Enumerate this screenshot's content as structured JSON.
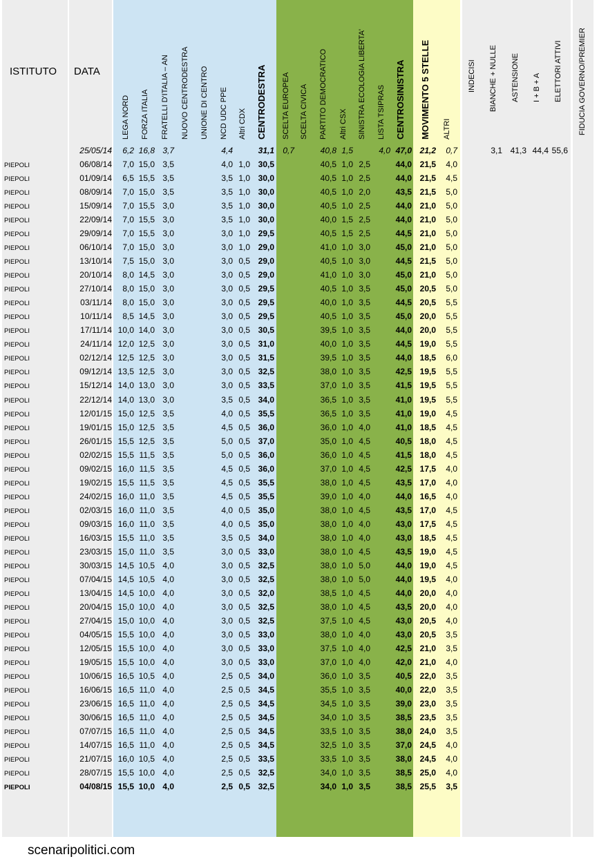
{
  "columns": {
    "istituto": "ISTITUTO",
    "data": "DATA",
    "lega_nord": "LEGA NORD",
    "forza_italia": "FORZA ITALIA",
    "fratelli_italia": "FRATELLI D'ITALIA – AN",
    "nuovo_centrodestra": "NUOVO  CENTRODESTRA",
    "unione_centro": "UNIONE DI CENTRO",
    "ncd_udc_ppe": "NCD UDC PPE",
    "altri_cdx": "Altri CDX",
    "centrodestra": "CENTRODESTRA",
    "scelta_europea": "SCELTA EUROPEA",
    "scelta_civica": "SCELTA CIVICA",
    "partito_democratico": "PARTITO DEMOCRATICO",
    "altri_csx": "Altri CSX",
    "sel": "SINISTRA ECOLOGIA LIBERTA'",
    "lista_tsipras": "LISTA TSIPRAS",
    "centrosinistra": "CENTROSINISTRA",
    "m5s": "MOVIMENTO 5 STELLE",
    "altri": "ALTRI",
    "indecisi": "INDECISI",
    "bianche_nulle": "BIANCHE + NULLE",
    "astensione": "ASTENSIONE",
    "ibna": "I + B + A",
    "elettori_attivi": "ELETTORI ATTIVI",
    "fiducia": "FIDUCIA GOVERNO/PREMIER"
  },
  "colors": {
    "grey_band": "#ededed",
    "blue_band": "#cde4f3",
    "green_band": "#89b24a",
    "yellow_band": "#fdfcc6"
  },
  "election_row": {
    "date": "25/05/14",
    "lega_nord": "6,2",
    "forza_italia": "16,8",
    "fratelli_italia": "3,7",
    "ncd_udc_ppe": "4,4",
    "centrodestra": "31,1",
    "scelta_europea": "0,7",
    "partito_democratico": "40,8",
    "altri_csx": "1,5",
    "lista_tsipras": "4,0",
    "centrosinistra": "47,0",
    "m5s": "21,2",
    "altri": "0,7",
    "bianche_nulle": "3,1",
    "astensione": "41,3",
    "ibna": "44,4",
    "elettori_attivi": "55,6"
  },
  "rows": [
    [
      "PIEPOLI",
      "06/08/14",
      "7,0",
      "15,0",
      "3,5",
      "4,0",
      "1,0",
      "30,5",
      "40,5",
      "1,0",
      "2,5",
      "44,0",
      "21,5",
      "4,0"
    ],
    [
      "PIEPOLI",
      "01/09/14",
      "6,5",
      "15,5",
      "3,5",
      "3,5",
      "1,0",
      "30,0",
      "40,5",
      "1,0",
      "2,5",
      "44,0",
      "21,5",
      "4,5"
    ],
    [
      "PIEPOLI",
      "08/09/14",
      "7,0",
      "15,0",
      "3,5",
      "3,5",
      "1,0",
      "30,0",
      "40,5",
      "1,0",
      "2,0",
      "43,5",
      "21,5",
      "5,0"
    ],
    [
      "PIEPOLI",
      "15/09/14",
      "7,0",
      "15,5",
      "3,0",
      "3,5",
      "1,0",
      "30,0",
      "40,5",
      "1,0",
      "2,5",
      "44,0",
      "21,0",
      "5,0"
    ],
    [
      "PIEPOLI",
      "22/09/14",
      "7,0",
      "15,5",
      "3,0",
      "3,5",
      "1,0",
      "30,0",
      "40,0",
      "1,5",
      "2,5",
      "44,0",
      "21,0",
      "5,0"
    ],
    [
      "PIEPOLI",
      "29/09/14",
      "7,0",
      "15,5",
      "3,0",
      "3,0",
      "1,0",
      "29,5",
      "40,5",
      "1,5",
      "2,5",
      "44,5",
      "21,0",
      "5,0"
    ],
    [
      "PIEPOLI",
      "06/10/14",
      "7,0",
      "15,0",
      "3,0",
      "3,0",
      "1,0",
      "29,0",
      "41,0",
      "1,0",
      "3,0",
      "45,0",
      "21,0",
      "5,0"
    ],
    [
      "PIEPOLI",
      "13/10/14",
      "7,5",
      "15,0",
      "3,0",
      "3,0",
      "0,5",
      "29,0",
      "40,5",
      "1,0",
      "3,0",
      "44,5",
      "21,5",
      "5,0"
    ],
    [
      "PIEPOLI",
      "20/10/14",
      "8,0",
      "14,5",
      "3,0",
      "3,0",
      "0,5",
      "29,0",
      "41,0",
      "1,0",
      "3,0",
      "45,0",
      "21,0",
      "5,0"
    ],
    [
      "PIEPOLI",
      "27/10/14",
      "8,0",
      "15,0",
      "3,0",
      "3,0",
      "0,5",
      "29,5",
      "40,5",
      "1,0",
      "3,5",
      "45,0",
      "20,5",
      "5,0"
    ],
    [
      "PIEPOLI",
      "03/11/14",
      "8,0",
      "15,0",
      "3,0",
      "3,0",
      "0,5",
      "29,5",
      "40,0",
      "1,0",
      "3,5",
      "44,5",
      "20,5",
      "5,5"
    ],
    [
      "PIEPOLI",
      "10/11/14",
      "8,5",
      "14,5",
      "3,0",
      "3,0",
      "0,5",
      "29,5",
      "40,5",
      "1,0",
      "3,5",
      "45,0",
      "20,0",
      "5,5"
    ],
    [
      "PIEPOLI",
      "17/11/14",
      "10,0",
      "14,0",
      "3,0",
      "3,0",
      "0,5",
      "30,5",
      "39,5",
      "1,0",
      "3,5",
      "44,0",
      "20,0",
      "5,5"
    ],
    [
      "PIEPOLI",
      "24/11/14",
      "12,0",
      "12,5",
      "3,0",
      "3,0",
      "0,5",
      "31,0",
      "40,0",
      "1,0",
      "3,5",
      "44,5",
      "19,0",
      "5,5"
    ],
    [
      "PIEPOLI",
      "02/12/14",
      "12,5",
      "12,5",
      "3,0",
      "3,0",
      "0,5",
      "31,5",
      "39,5",
      "1,0",
      "3,5",
      "44,0",
      "18,5",
      "6,0"
    ],
    [
      "PIEPOLI",
      "09/12/14",
      "13,5",
      "12,5",
      "3,0",
      "3,0",
      "0,5",
      "32,5",
      "38,0",
      "1,0",
      "3,5",
      "42,5",
      "19,5",
      "5,5"
    ],
    [
      "PIEPOLI",
      "15/12/14",
      "14,0",
      "13,0",
      "3,0",
      "3,0",
      "0,5",
      "33,5",
      "37,0",
      "1,0",
      "3,5",
      "41,5",
      "19,5",
      "5,5"
    ],
    [
      "PIEPOLI",
      "22/12/14",
      "14,0",
      "13,0",
      "3,0",
      "3,5",
      "0,5",
      "34,0",
      "36,5",
      "1,0",
      "3,5",
      "41,0",
      "19,5",
      "5,5"
    ],
    [
      "PIEPOLI",
      "12/01/15",
      "15,0",
      "12,5",
      "3,5",
      "4,0",
      "0,5",
      "35,5",
      "36,5",
      "1,0",
      "3,5",
      "41,0",
      "19,0",
      "4,5"
    ],
    [
      "PIEPOLI",
      "19/01/15",
      "15,0",
      "12,5",
      "3,5",
      "4,5",
      "0,5",
      "36,0",
      "36,0",
      "1,0",
      "4,0",
      "41,0",
      "18,5",
      "4,5"
    ],
    [
      "PIEPOLI",
      "26/01/15",
      "15,5",
      "12,5",
      "3,5",
      "5,0",
      "0,5",
      "37,0",
      "35,0",
      "1,0",
      "4,5",
      "40,5",
      "18,0",
      "4,5"
    ],
    [
      "PIEPOLI",
      "02/02/15",
      "15,5",
      "11,5",
      "3,5",
      "5,0",
      "0,5",
      "36,0",
      "36,0",
      "1,0",
      "4,5",
      "41,5",
      "18,0",
      "4,5"
    ],
    [
      "PIEPOLI",
      "09/02/15",
      "16,0",
      "11,5",
      "3,5",
      "4,5",
      "0,5",
      "36,0",
      "37,0",
      "1,0",
      "4,5",
      "42,5",
      "17,5",
      "4,0"
    ],
    [
      "PIEPOLI",
      "19/02/15",
      "15,5",
      "11,5",
      "3,5",
      "4,5",
      "0,5",
      "35,5",
      "38,0",
      "1,0",
      "4,5",
      "43,5",
      "17,0",
      "4,0"
    ],
    [
      "PIEPOLI",
      "24/02/15",
      "16,0",
      "11,0",
      "3,5",
      "4,5",
      "0,5",
      "35,5",
      "39,0",
      "1,0",
      "4,0",
      "44,0",
      "16,5",
      "4,0"
    ],
    [
      "PIEPOLI",
      "02/03/15",
      "16,0",
      "11,0",
      "3,5",
      "4,0",
      "0,5",
      "35,0",
      "38,0",
      "1,0",
      "4,5",
      "43,5",
      "17,0",
      "4,5"
    ],
    [
      "PIEPOLI",
      "09/03/15",
      "16,0",
      "11,0",
      "3,5",
      "4,0",
      "0,5",
      "35,0",
      "38,0",
      "1,0",
      "4,0",
      "43,0",
      "17,5",
      "4,5"
    ],
    [
      "PIEPOLI",
      "16/03/15",
      "15,5",
      "11,0",
      "3,5",
      "3,5",
      "0,5",
      "34,0",
      "38,0",
      "1,0",
      "4,0",
      "43,0",
      "18,5",
      "4,5"
    ],
    [
      "PIEPOLI",
      "23/03/15",
      "15,0",
      "11,0",
      "3,5",
      "3,0",
      "0,5",
      "33,0",
      "38,0",
      "1,0",
      "4,5",
      "43,5",
      "19,0",
      "4,5"
    ],
    [
      "PIEPOLI",
      "30/03/15",
      "14,5",
      "10,5",
      "4,0",
      "3,0",
      "0,5",
      "32,5",
      "38,0",
      "1,0",
      "5,0",
      "44,0",
      "19,0",
      "4,5"
    ],
    [
      "PIEPOLI",
      "07/04/15",
      "14,5",
      "10,5",
      "4,0",
      "3,0",
      "0,5",
      "32,5",
      "38,0",
      "1,0",
      "5,0",
      "44,0",
      "19,5",
      "4,0"
    ],
    [
      "PIEPOLI",
      "13/04/15",
      "14,5",
      "10,0",
      "4,0",
      "3,0",
      "0,5",
      "32,0",
      "38,5",
      "1,0",
      "4,5",
      "44,0",
      "20,0",
      "4,0"
    ],
    [
      "PIEPOLI",
      "20/04/15",
      "15,0",
      "10,0",
      "4,0",
      "3,0",
      "0,5",
      "32,5",
      "38,0",
      "1,0",
      "4,5",
      "43,5",
      "20,0",
      "4,0"
    ],
    [
      "PIEPOLI",
      "27/04/15",
      "15,0",
      "10,0",
      "4,0",
      "3,0",
      "0,5",
      "32,5",
      "37,5",
      "1,0",
      "4,5",
      "43,0",
      "20,5",
      "4,0"
    ],
    [
      "PIEPOLI",
      "04/05/15",
      "15,5",
      "10,0",
      "4,0",
      "3,0",
      "0,5",
      "33,0",
      "38,0",
      "1,0",
      "4,0",
      "43,0",
      "20,5",
      "3,5"
    ],
    [
      "PIEPOLI",
      "12/05/15",
      "15,5",
      "10,0",
      "4,0",
      "3,0",
      "0,5",
      "33,0",
      "37,5",
      "1,0",
      "4,0",
      "42,5",
      "21,0",
      "3,5"
    ],
    [
      "PIEPOLI",
      "19/05/15",
      "15,5",
      "10,0",
      "4,0",
      "3,0",
      "0,5",
      "33,0",
      "37,0",
      "1,0",
      "4,0",
      "42,0",
      "21,0",
      "4,0"
    ],
    [
      "PIEPOLI",
      "10/06/15",
      "16,5",
      "10,5",
      "4,0",
      "2,5",
      "0,5",
      "34,0",
      "36,0",
      "1,0",
      "3,5",
      "40,5",
      "22,0",
      "3,5"
    ],
    [
      "PIEPOLI",
      "16/06/15",
      "16,5",
      "11,0",
      "4,0",
      "2,5",
      "0,5",
      "34,5",
      "35,5",
      "1,0",
      "3,5",
      "40,0",
      "22,0",
      "3,5"
    ],
    [
      "PIEPOLI",
      "23/06/15",
      "16,5",
      "11,0",
      "4,0",
      "2,5",
      "0,5",
      "34,5",
      "34,5",
      "1,0",
      "3,5",
      "39,0",
      "23,0",
      "3,5"
    ],
    [
      "PIEPOLI",
      "30/06/15",
      "16,5",
      "11,0",
      "4,0",
      "2,5",
      "0,5",
      "34,5",
      "34,0",
      "1,0",
      "3,5",
      "38,5",
      "23,5",
      "3,5"
    ],
    [
      "PIEPOLI",
      "07/07/15",
      "16,5",
      "11,0",
      "4,0",
      "2,5",
      "0,5",
      "34,5",
      "33,5",
      "1,0",
      "3,5",
      "38,0",
      "24,0",
      "3,5"
    ],
    [
      "PIEPOLI",
      "14/07/15",
      "16,5",
      "11,0",
      "4,0",
      "2,5",
      "0,5",
      "34,5",
      "32,5",
      "1,0",
      "3,5",
      "37,0",
      "24,5",
      "4,0"
    ],
    [
      "PIEPOLI",
      "21/07/15",
      "16,0",
      "10,5",
      "4,0",
      "2,5",
      "0,5",
      "33,5",
      "33,5",
      "1,0",
      "3,5",
      "38,0",
      "24,5",
      "4,0"
    ],
    [
      "PIEPOLI",
      "28/07/15",
      "15,5",
      "10,0",
      "4,0",
      "2,5",
      "0,5",
      "32,5",
      "34,0",
      "1,0",
      "3,5",
      "38,5",
      "25,0",
      "4,0"
    ],
    [
      "PIEPOLI",
      "04/08/15",
      "15,5",
      "10,0",
      "4,0",
      "2,5",
      "0,5",
      "32,5",
      "34,0",
      "1,0",
      "3,5",
      "38,5",
      "25,5",
      "3,5"
    ]
  ],
  "footer": "scenaripolitici.com"
}
